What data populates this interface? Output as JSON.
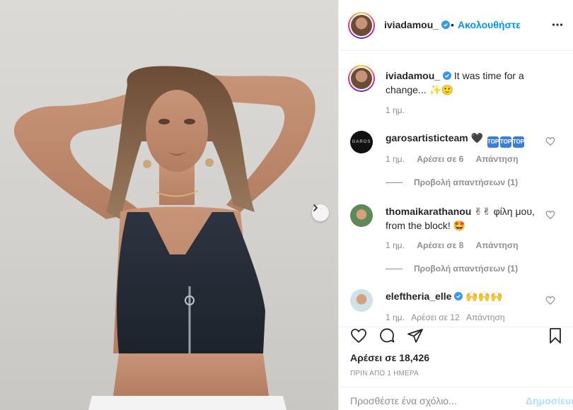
{
  "post": {
    "username": "iviadamou_",
    "follow_label": "Ακολουθήστε",
    "dot": "•",
    "caption": "It was time for a change...",
    "caption_emoji": "✨🙂",
    "caption_time": "1 ημ."
  },
  "comments": [
    {
      "username": "garosartisticteam",
      "text": "🖤",
      "badges": [
        "TOP",
        "TOP",
        "TOP"
      ],
      "time": "1 ημ.",
      "likes": "Αρέσει σε 6",
      "reply": "Απάντηση",
      "view_replies": "Προβολή απαντήσεων (1)",
      "avatar_text": "GAROS"
    },
    {
      "username": "thomaikarathanou",
      "text": "✌✌ φίλη μου, from the block! 🤩",
      "time": "1 ημ.",
      "likes": "Αρέσει σε 8",
      "reply": "Απάντηση",
      "view_replies": "Προβολή απαντήσεων (1)"
    },
    {
      "username": "eleftheria_elle",
      "text": "🙌🙌🙌",
      "meta_partial": "1 ημ.   Αρέσει σε 12   Απάντηση"
    }
  ],
  "footer": {
    "likes": "Αρέσει σε 18,426",
    "time_ago": "ΠΡΙΝ ΑΠΟ 1 ΗΜΕΡΑ",
    "comment_placeholder": "Προσθέστε ένα σχόλιο...",
    "post_label": "Δημοσίευση"
  },
  "colors": {
    "accent": "#0095f6",
    "text": "#262626",
    "muted": "#8e8e8e",
    "post_disabled": "#b2dffc"
  },
  "icons": [
    "more-icon",
    "heart-icon",
    "comment-icon",
    "share-icon",
    "bookmark-icon",
    "chevron-right-icon",
    "verified-badge-icon"
  ]
}
